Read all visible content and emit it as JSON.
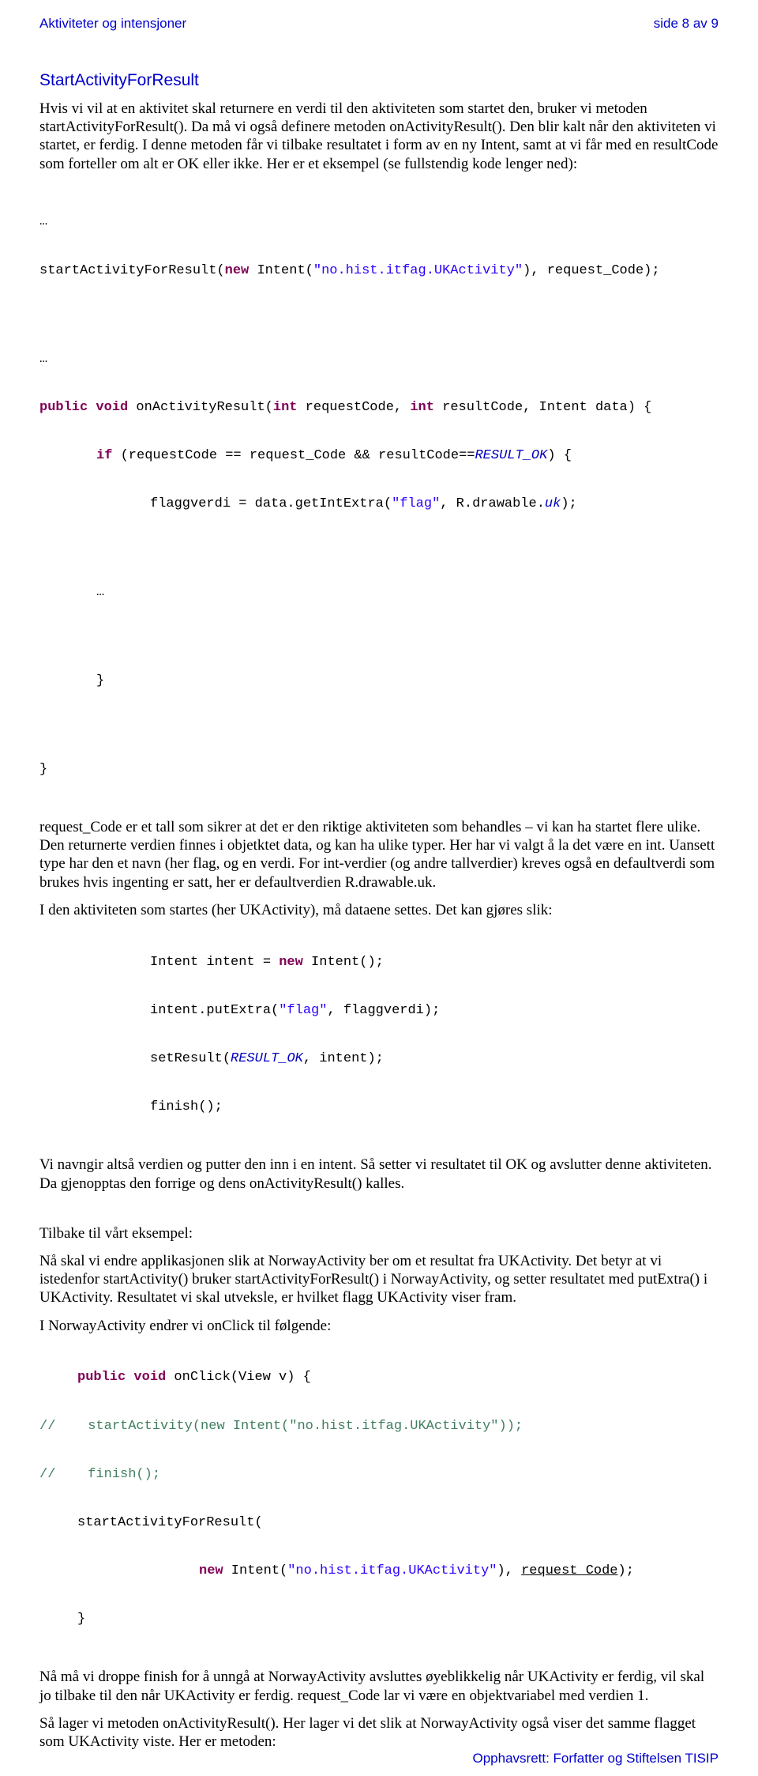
{
  "header": {
    "left": "Aktiviteter og intensjoner",
    "right": "side 8 av 9"
  },
  "title": "StartActivityForResult",
  "p1": "Hvis vi vil at en aktivitet skal returnere en verdi til den aktiviteten som startet den, bruker vi metoden startActivityForResult(). Da må vi også definere metoden onActivityResult(). Den blir kalt når den aktiviteten vi startet, er ferdig. I denne metoden får vi tilbake resultatet i form av en ny Intent, samt at vi får med en resultCode som forteller om alt er OK eller ikke. Her er et eksempel (se fullstendig kode lenger ned):",
  "code1": {
    "ellipsis1": "…",
    "l1a": "startActivityForResult(",
    "l1b": "new",
    "l1c": " Intent(",
    "l1d": "\"no.hist.itfag.UKActivity\"",
    "l1e": "), request_Code);",
    "ellipsis2": "…",
    "l2a": "public",
    "l2b": " void",
    "l2c": " onActivityResult(",
    "l2d": "int",
    "l2e": " requestCode, ",
    "l2f": "int",
    "l2g": " resultCode, Intent data) {",
    "l3a": "if",
    "l3b": " (requestCode == request_Code && resultCode==",
    "l3c": "RESULT_OK",
    "l3d": ") {",
    "l4a": "flaggverdi = data.getIntExtra(",
    "l4b": "\"flag\"",
    "l4c": ", R.drawable.",
    "l4d": "uk",
    "l4e": ");",
    "ellipsis3": "…",
    "brace1": "}",
    "brace2": "}"
  },
  "p2": "request_Code er et tall som sikrer at det er den riktige aktiviteten som behandles – vi kan ha startet flere ulike. Den returnerte verdien finnes i objetktet data, og kan ha ulike typer. Her har vi valgt å la det være en int. Uansett type har den et navn (her flag, og en verdi. For int-verdier (og andre tallverdier) kreves også en defaultverdi som brukes hvis ingenting er satt, her er defaultverdien R.drawable.uk.",
  "p3": "I den aktiviteten som startes (her UKActivity), må dataene settes. Det kan gjøres slik:",
  "code2": {
    "l1a": "Intent intent = ",
    "l1b": "new",
    "l1c": " Intent();",
    "l2a": "intent.putExtra(",
    "l2b": "\"flag\"",
    "l2c": ", flaggverdi);",
    "l3a": "setResult(",
    "l3b": "RESULT_OK",
    "l3c": ", intent);",
    "l4": "finish();"
  },
  "p4": "Vi navngir altså verdien og putter den inn i en intent. Så setter vi resultatet til OK og avslutter denne aktiviteten. Da gjenopptas den forrige og dens onActivityResult() kalles.",
  "p5": "Tilbake til vårt eksempel:",
  "p6": "Nå skal vi endre applikasjonen slik at NorwayActivity ber om et resultat fra UKActivity. Det betyr at vi istedenfor startActivity() bruker startActivityForResult() i NorwayActivity, og setter resultatet med putExtra() i UKActivity. Resultatet vi skal utveksle, er hvilket flagg UKActivity viser fram.",
  "p7": "I NorwayActivity endrer vi onClick til følgende:",
  "code3": {
    "l1a": "public",
    "l1b": " void",
    "l1c": " onClick(View v) {",
    "l2a": "//",
    "l2b": "    startActivity(new Intent(\"no.hist.itfag.UKActivity\"));",
    "l3a": "//",
    "l3b": "    finish();",
    "l4": "startActivityForResult(",
    "l5a": "new",
    "l5b": " Intent(",
    "l5c": "\"no.hist.itfag.UKActivity\"",
    "l5d": "), ",
    "l5e": "request_Code",
    "l5f": ");",
    "brace": "}"
  },
  "p8": "Nå må vi droppe finish for å unngå at NorwayActivity avsluttes øyeblikkelig når UKActivity er ferdig, vil skal jo tilbake til den når UKActivity er ferdig. request_Code lar vi være en objektvariabel med verdien 1.",
  "p9": "Så lager vi metoden onActivityResult(). Her lager vi det slik at NorwayActivity også viser det samme flagget som UKActivity viste. Her er metoden:",
  "footer": "Opphavsrett:  Forfatter og Stiftelsen TISIP"
}
